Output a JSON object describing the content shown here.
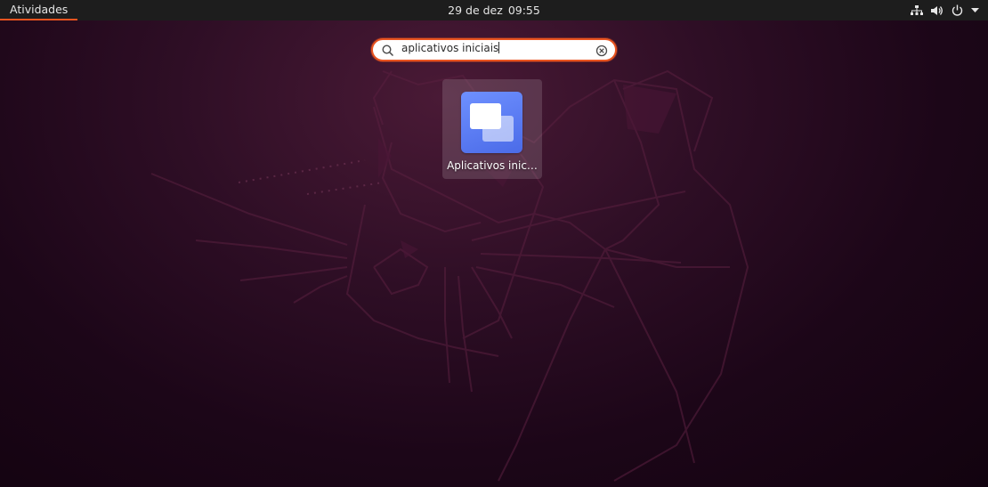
{
  "topbar": {
    "activities_label": "Atividades",
    "date": "29 de dez",
    "time": "09:55",
    "tray_icons": [
      "network-icon",
      "volume-icon",
      "power-icon",
      "chevron-down-icon"
    ]
  },
  "search": {
    "value": "aplicativos iniciais",
    "icon": "search-icon",
    "clear_icon": "clear-icon"
  },
  "results": [
    {
      "label": "Aplicativos inic…",
      "icon": "startup-applications-icon"
    }
  ],
  "colors": {
    "accent": "#e95420",
    "topbar_bg": "#1d1d1d",
    "app_icon": "#5a7cf5",
    "wallpaper": "#2c0a22"
  }
}
